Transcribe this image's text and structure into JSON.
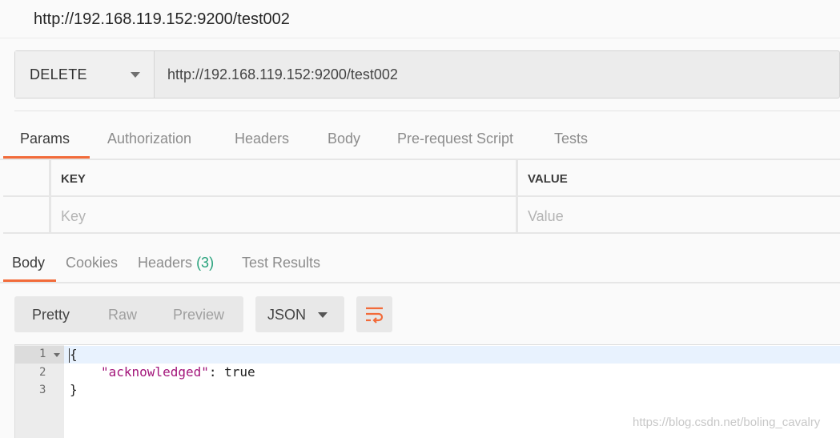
{
  "title_bar": {
    "title": "http://192.168.119.152:9200/test002"
  },
  "request": {
    "method": "DELETE",
    "url": "http://192.168.119.152:9200/test002"
  },
  "request_tabs": [
    "Params",
    "Authorization",
    "Headers",
    "Body",
    "Pre-request Script",
    "Tests"
  ],
  "params_table": {
    "headers": {
      "key": "KEY",
      "value": "VALUE"
    },
    "placeholders": {
      "key": "Key",
      "value": "Value"
    }
  },
  "response_tabs": {
    "body": "Body",
    "cookies": "Cookies",
    "headers": "Headers",
    "headers_count": "(3)",
    "test_results": "Test Results"
  },
  "response_view": {
    "modes": [
      "Pretty",
      "Raw",
      "Preview"
    ],
    "format": "JSON",
    "wrap_icon": "wrap-lines-icon"
  },
  "editor": {
    "line_numbers": [
      "1",
      "2",
      "3"
    ],
    "lines": {
      "open": "{",
      "key": "\"acknowledged\"",
      "sep": ": ",
      "value": "true",
      "close": "}"
    }
  },
  "watermark": "https://blog.csdn.net/boling_cavalry",
  "colors": {
    "accent": "#f26b3a",
    "count": "#26a17b",
    "json_key": "#a3157a"
  }
}
